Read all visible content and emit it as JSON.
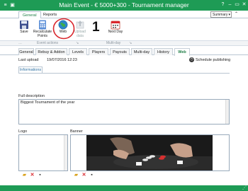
{
  "window": {
    "title": "Main Event - € 5000+300 - Tournament manager",
    "help": "?",
    "restore": "▭",
    "minimize": "–",
    "close": "✕"
  },
  "ribbon_tabs": [
    {
      "label": "General"
    },
    {
      "label": "Reports"
    }
  ],
  "summary_select": {
    "value": "Summary"
  },
  "ribbon": {
    "save": "Save",
    "recalculate": "Recalculate Points",
    "web": "Web",
    "upload": "Upload data",
    "level_number": "1",
    "next_day": "Next Day"
  },
  "groups": {
    "event_actions": "Event actions",
    "multi_day": "Multi-day"
  },
  "main_tabs": [
    {
      "label": "General"
    },
    {
      "label": "Rebuy & Addon"
    },
    {
      "label": "Levels"
    },
    {
      "label": "Players"
    },
    {
      "label": "Payouts"
    },
    {
      "label": "Multi-day"
    },
    {
      "label": "History"
    },
    {
      "label": "Web"
    }
  ],
  "upload": {
    "label": "Last upload",
    "value": "19/07/2016 12:23"
  },
  "schedule_publishing": "Schedule publishing",
  "info_tab": "Informations",
  "full_description": {
    "label": "Full description",
    "value": "Biggest Tournament of the year"
  },
  "logo_label": "Logo",
  "banner_label": "Banner",
  "colors": {
    "accent": "#1e9b55",
    "highlight_circle": "#d9262c"
  }
}
